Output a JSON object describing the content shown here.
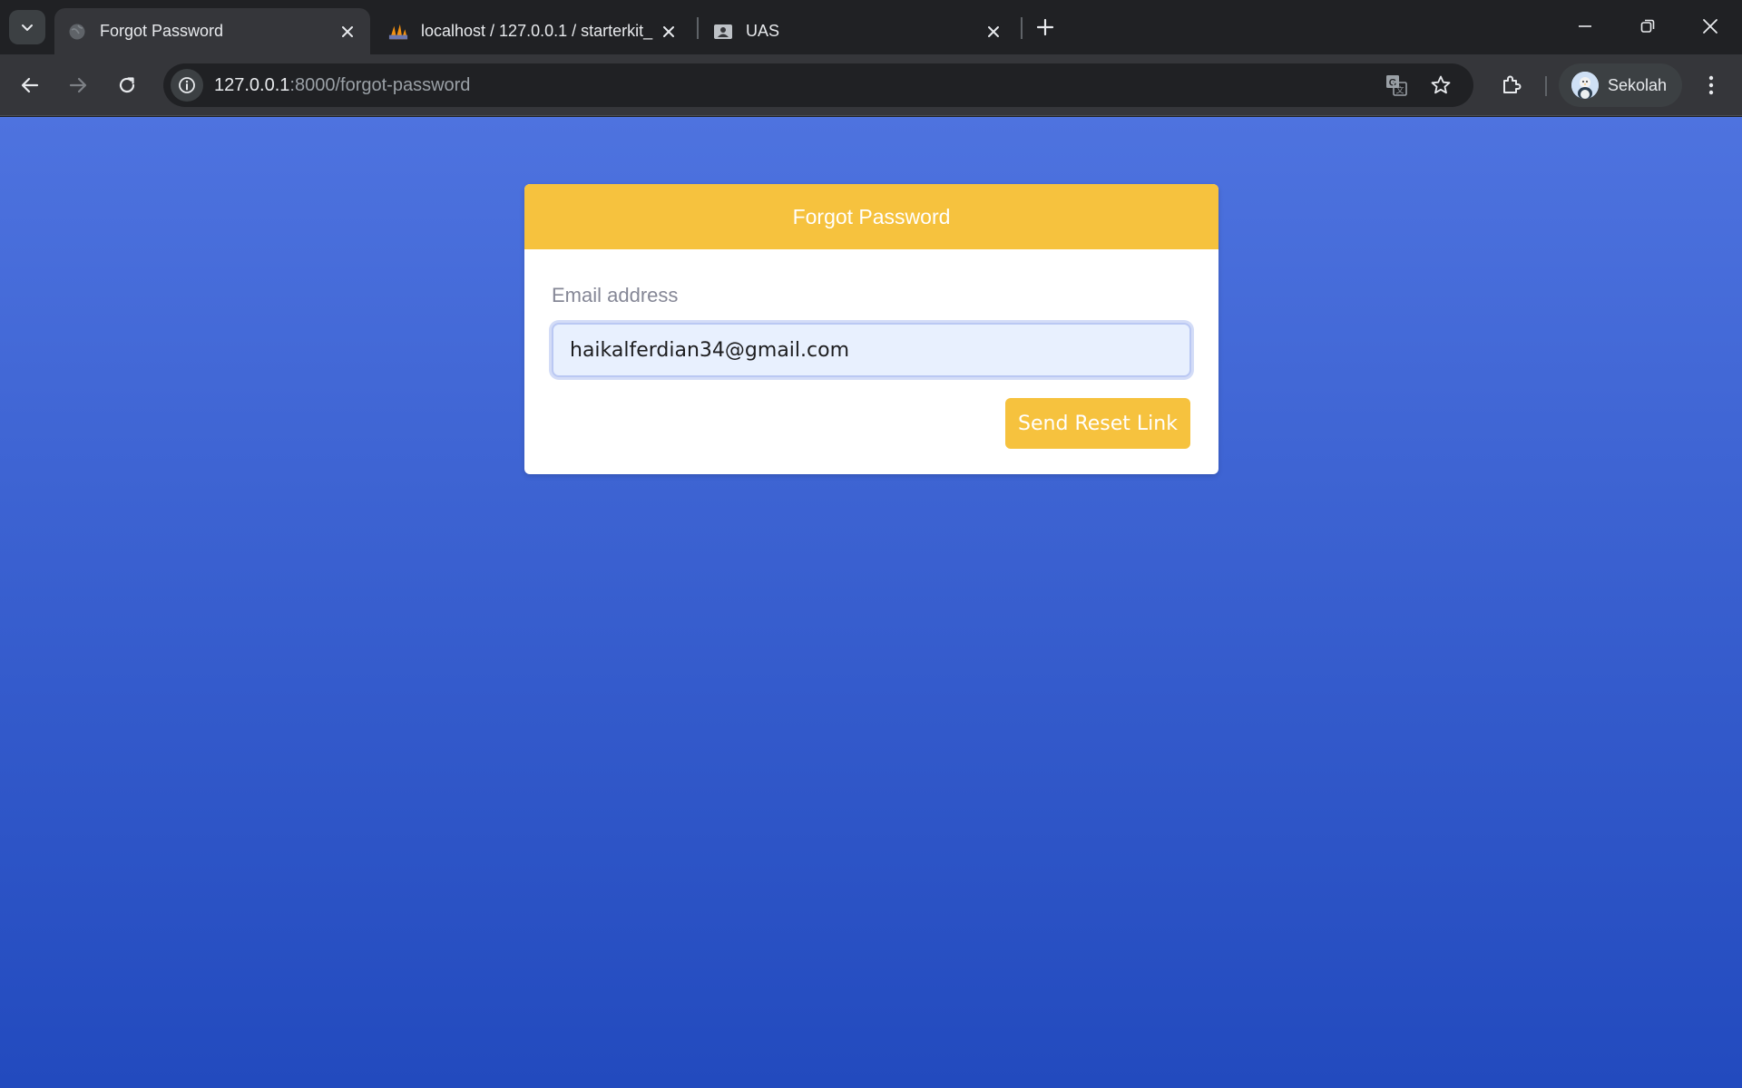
{
  "browser": {
    "tabs": [
      {
        "title": "Forgot Password",
        "active": true,
        "favicon": "globe-icon"
      },
      {
        "title": "localhost / 127.0.0.1 / starterkit_",
        "active": false,
        "favicon": "phpmyadmin-icon"
      },
      {
        "title": "UAS",
        "active": false,
        "favicon": "contact-card-icon"
      }
    ],
    "address": {
      "host": "127.0.0.1",
      "rest": ":8000/forgot-password"
    },
    "profile": {
      "name": "Sekolah"
    }
  },
  "page": {
    "card": {
      "header": "Forgot Password",
      "email_label": "Email address",
      "email_value": "haikalferdian34@gmail.com",
      "submit_label": "Send Reset Link"
    }
  },
  "colors": {
    "primary_gradient_top": "#4e73df",
    "primary_gradient_bottom": "#224abe",
    "warning": "#f6c23e",
    "label_gray": "#858796"
  }
}
